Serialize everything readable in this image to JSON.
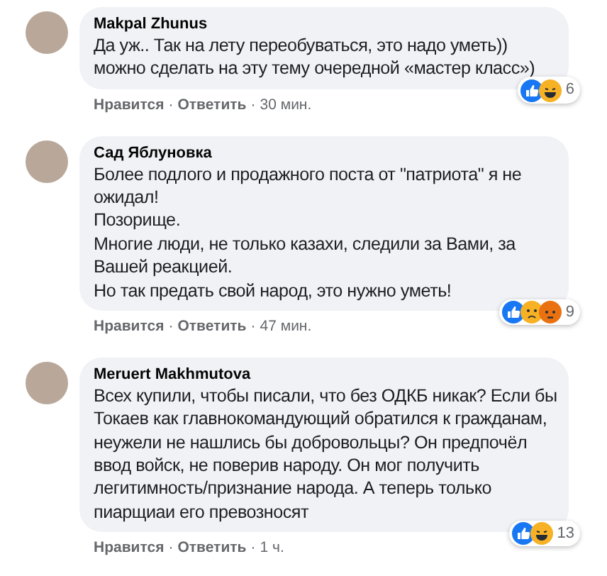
{
  "comments": [
    {
      "author": "Makpal Zhunus",
      "paragraphs": [
        "Да уж.. Так на лету переобуваться, это надо уметь))",
        "можно сделать на эту тему очередной «мастер класс»)"
      ],
      "reactions": [
        {
          "kind": "like"
        },
        {
          "kind": "haha"
        }
      ],
      "reaction_count": "6",
      "actions": {
        "like": "Нравится",
        "separator": "·",
        "reply": "Ответить",
        "separator_2": "·",
        "time": "30 мин."
      }
    },
    {
      "author": "Сад Яблуновка",
      "paragraphs": [
        "Более подлого и продажного поста от \"патриота\" я не ожидал!",
        "Позорище.",
        "Многие люди, не только казахи, следили за Вами, за Вашей реакцией.",
        "Но так предать свой народ, это нужно уметь!"
      ],
      "reactions": [
        {
          "kind": "like"
        },
        {
          "kind": "sad"
        },
        {
          "kind": "angry"
        }
      ],
      "reaction_count": "9",
      "actions": {
        "like": "Нравится",
        "separator": "·",
        "reply": "Ответить",
        "separator_2": "·",
        "time": "47 мин."
      }
    },
    {
      "author": "Meruert Makhmutova",
      "paragraphs": [
        "Всех купили, чтобы писали, что без ОДКБ никак? Если бы Токаев как главнокомандующий обратился к гражданам, неужели не нашлись бы добровольцы? Он предпочёл ввод войск, не поверив народу. Он мог получить легитимность/признание народа. А теперь только пиарщиаи его превозносят"
      ],
      "reactions": [
        {
          "kind": "like"
        },
        {
          "kind": "haha"
        }
      ],
      "reaction_count": "13",
      "actions": {
        "like": "Нравится",
        "separator": "·",
        "reply": "Ответить",
        "separator_2": "·",
        "time": "1 ч."
      }
    }
  ]
}
